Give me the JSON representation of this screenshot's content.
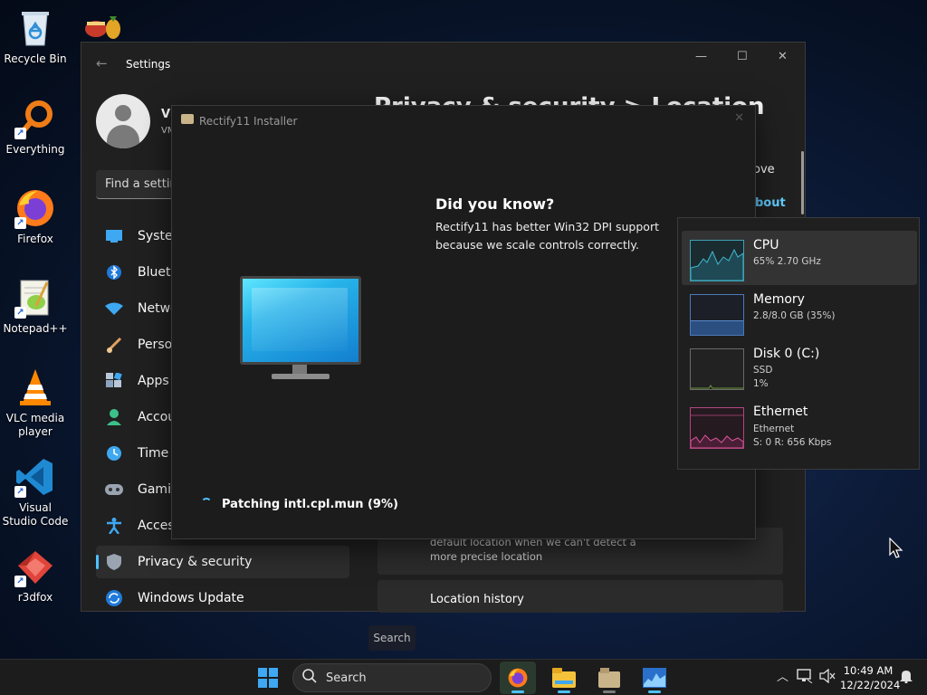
{
  "desktop_icons": [
    {
      "label": "Recycle Bin",
      "icon": "recycle-bin-icon"
    },
    {
      "label": "Everything",
      "icon": "everything-search-icon"
    },
    {
      "label": "Firefox",
      "icon": "firefox-icon"
    },
    {
      "label": "Notepad++",
      "icon": "notepad-plus-plus-icon"
    },
    {
      "label": "VLC media player",
      "icon": "vlc-icon"
    },
    {
      "label": "Visual Studio Code",
      "icon": "vscode-icon"
    },
    {
      "label": "r3dfox",
      "icon": "r3dfox-icon"
    }
  ],
  "settings": {
    "title": "Settings",
    "user": {
      "name": "VM",
      "sub": "VM"
    },
    "search_placeholder": "Find a setting",
    "nav": [
      {
        "label": "System",
        "icon": "system-icon"
      },
      {
        "label": "Bluetooth",
        "icon": "bluetooth-icon"
      },
      {
        "label": "Network",
        "icon": "wifi-icon"
      },
      {
        "label": "Personalization",
        "icon": "brush-icon"
      },
      {
        "label": "Apps",
        "icon": "apps-icon"
      },
      {
        "label": "Accounts",
        "icon": "account-icon"
      },
      {
        "label": "Time &",
        "icon": "clock-icon"
      },
      {
        "label": "Gaming",
        "icon": "gamepad-icon"
      },
      {
        "label": "Accessibility",
        "icon": "accessibility-icon"
      },
      {
        "label": "Privacy & security",
        "icon": "shield-icon"
      },
      {
        "label": "Windows Update",
        "icon": "update-icon"
      }
    ],
    "active_nav": "Privacy & security",
    "heading": "Privacy & security  >  Location",
    "right_fragments": {
      "ove": "ove",
      "about": "bout"
    },
    "card_text": "default location when we can't detect a more precise location",
    "location_history": "Location history"
  },
  "installer": {
    "title": "Rectify11 Installer",
    "dyk_title": "Did you know?",
    "dyk_body": "Rectify11 has better Win32 DPI support because we scale controls correctly.",
    "status": "Patching intl.cpl.mun (9%)"
  },
  "task_manager": {
    "items": [
      {
        "name": "CPU",
        "lines": [
          "65% 2.70 GHz"
        ],
        "color": "#3f9fb3"
      },
      {
        "name": "Memory",
        "lines": [
          "2.8/8.0 GB (35%)"
        ],
        "color": "#4a79b8"
      },
      {
        "name": "Disk 0 (C:)",
        "lines": [
          "SSD",
          "1%"
        ],
        "color": "#6a9a3a"
      },
      {
        "name": "Ethernet",
        "lines": [
          "Ethernet",
          "S: 0 R: 656 Kbps"
        ],
        "color": "#b5457e"
      }
    ]
  },
  "taskbar": {
    "search_tooltip": "Search",
    "search_label": "Search",
    "apps": [
      "firefox-icon",
      "file-explorer-icon",
      "installer-icon",
      "task-manager-icon"
    ],
    "time": "10:49 AM",
    "date": "12/22/2024"
  }
}
